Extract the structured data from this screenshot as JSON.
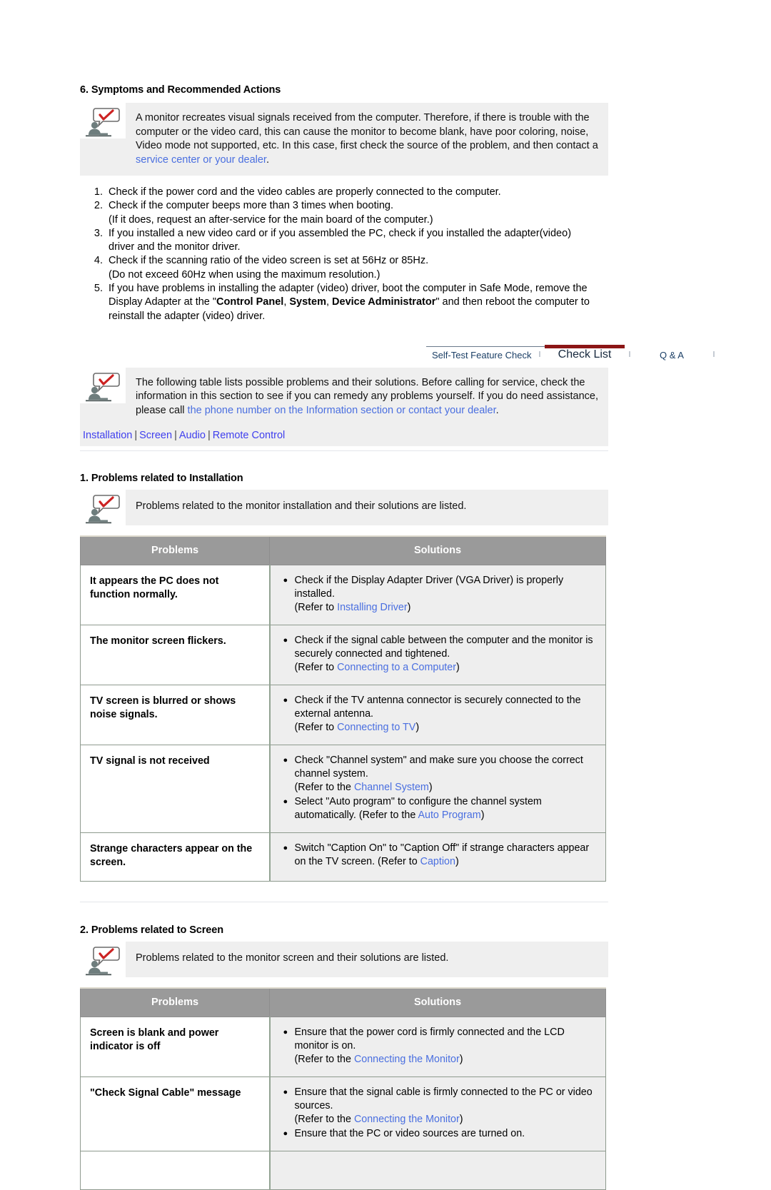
{
  "section6": {
    "heading": "6. Symptoms and Recommended Actions",
    "note": {
      "text_1": "A monitor recreates visual signals received from the computer. Therefore, if there is trouble with the computer or the video card, this can cause the monitor to become blank, have poor coloring, noise, Video mode not supported, etc. In this case, first check the source of the problem, and then contact a ",
      "link": "service center or your dealer",
      "text_2": "."
    },
    "steps": [
      {
        "num": "1.",
        "line1": "Check if the power cord and the video cables are properly connected to the computer.",
        "line2": ""
      },
      {
        "num": "2.",
        "line1": "Check if the computer beeps more than 3 times when booting.",
        "line2": "(If it does, request an after-service for the main board of the computer.)"
      },
      {
        "num": "3.",
        "line1": "If you installed a new video card or if you assembled the PC, check if you installed the adapter(video)",
        "line2": "driver and the monitor driver."
      },
      {
        "num": "4.",
        "line1": "Check if the scanning ratio of the video screen is set at 56Hz or 85Hz.",
        "line2": "(Do not exceed 60Hz when using the maximum resolution.)"
      }
    ],
    "step5": {
      "num": "5.",
      "part1": "If you have problems in installing the adapter (video) driver, boot the computer in Safe Mode, remove the Display Adapter at the \"",
      "kw1": "Control Panel",
      "sep1": ", ",
      "kw2": "System",
      "sep2": ", ",
      "kw3": "Device Administrator",
      "part2": "\" and then reboot the computer to reinstall the adapter (video) driver."
    }
  },
  "tabs": [
    {
      "label": "Self-Test Feature Check",
      "active": false
    },
    {
      "label": "Check List",
      "active": true
    },
    {
      "label": "Q & A",
      "active": false
    }
  ],
  "tab_separator": "l",
  "intro": {
    "note": {
      "text_1": "The following table lists possible problems and their solutions. Before calling for service, check the information in this section to see if you can remedy any problems yourself. If you do need assistance, please call ",
      "link": "the phone number on the Information section or contact your dealer",
      "text_2": "."
    },
    "subnav": [
      "Installation",
      "Screen",
      "Audio",
      "Remote Control"
    ],
    "subnav_separator": "|"
  },
  "table_headers": {
    "problems": "Problems",
    "solutions": "Solutions"
  },
  "section1": {
    "heading": "1. Problems related to Installation",
    "note": "Problems related to the monitor installation and their solutions are listed.",
    "rows": [
      {
        "problem": "It appears the PC does not function normally.",
        "solutions": [
          {
            "text_1": "Check if the Display Adapter Driver (VGA Driver) is properly installed.",
            "refer_prefix": "(Refer to ",
            "refer_link": "Installing Driver",
            "refer_suffix": ")"
          }
        ]
      },
      {
        "problem": "The monitor screen flickers.",
        "solutions": [
          {
            "text_1": "Check if the signal cable between the computer and the monitor is securely connected and tightened.",
            "refer_prefix": "(Refer to ",
            "refer_link": "Connecting to a Computer",
            "refer_suffix": ")"
          }
        ]
      },
      {
        "problem": "TV screen is blurred or shows noise signals.",
        "solutions": [
          {
            "text_1": "Check if the TV antenna connector is securely connected to the external antenna.",
            "refer_prefix": "(Refer to ",
            "refer_link": "Connecting to TV",
            "refer_suffix": ")"
          }
        ]
      },
      {
        "problem": "TV signal is not received",
        "solutions": [
          {
            "text_1": "Check \"Channel system\" and make sure you choose the correct channel system.",
            "refer_prefix": "(Refer to the ",
            "refer_link": "Channel System",
            "refer_suffix": ")"
          },
          {
            "text_1": "Select \"Auto program\" to configure the channel system automatically. (Refer to the ",
            "refer_prefix": "",
            "refer_link": "Auto Program",
            "refer_suffix": ")",
            "inline": true
          }
        ]
      },
      {
        "problem": "Strange characters appear on the screen.",
        "solutions": [
          {
            "text_1": "Switch \"Caption On\" to \"Caption Off\" if strange characters appear on the TV screen. (Refer to ",
            "refer_prefix": "",
            "refer_link": "Caption",
            "refer_suffix": ")",
            "inline": true
          }
        ]
      }
    ]
  },
  "section2": {
    "heading": "2. Problems related to Screen",
    "note": "Problems related to the monitor screen and their solutions are listed.",
    "rows": [
      {
        "problem": "Screen is blank and power indicator is off",
        "solutions": [
          {
            "text_1": "Ensure that the power cord is firmly connected and the LCD monitor is on.",
            "refer_prefix": "(Refer to the ",
            "refer_link": "Connecting the Monitor",
            "refer_suffix": ")"
          }
        ]
      },
      {
        "problem": "\"Check Signal Cable\" message",
        "solutions": [
          {
            "text_1": "Ensure that the signal cable is firmly connected to the PC or video sources.",
            "refer_prefix": "(Refer to the ",
            "refer_link": "Connecting the Monitor",
            "refer_suffix": ")"
          },
          {
            "text_1": "Ensure that the PC or video sources are turned on.",
            "refer_prefix": "",
            "refer_link": "",
            "refer_suffix": ""
          }
        ]
      }
    ]
  },
  "colors": {
    "link": "#4a6fe0",
    "nav_link": "#4040ee",
    "table_header_bg": "#9a9a9a",
    "solution_bg": "#eeeeee",
    "note_bg": "#efefef",
    "active_tab_accent": "#8c1616",
    "tab_text": "#1b3f66"
  },
  "icons": {
    "note": "person-speech-bubble-check-icon",
    "bullet": "●"
  }
}
